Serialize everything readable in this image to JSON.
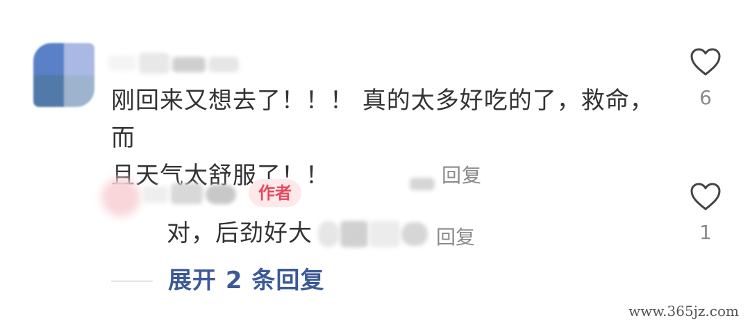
{
  "comment": {
    "line1": "刚回来又想去了！！！ 真的太多好吃的了，救命，而",
    "line2": "且天气太舒服了！！",
    "reply_label": "回复",
    "like_count": "6"
  },
  "reply": {
    "author_badge": "作者",
    "text": "对，后劲好大",
    "reply_label": "回复",
    "like_count": "1"
  },
  "expand": {
    "label": "展开 2 条回复"
  },
  "watermark": "www.365jz.com",
  "colors": {
    "link": "#3b5998",
    "badge_text": "#e44a5e",
    "badge_bg": "#fde8ea",
    "muted": "#8a8a8a"
  },
  "icons": [
    "heart-outline-icon"
  ]
}
